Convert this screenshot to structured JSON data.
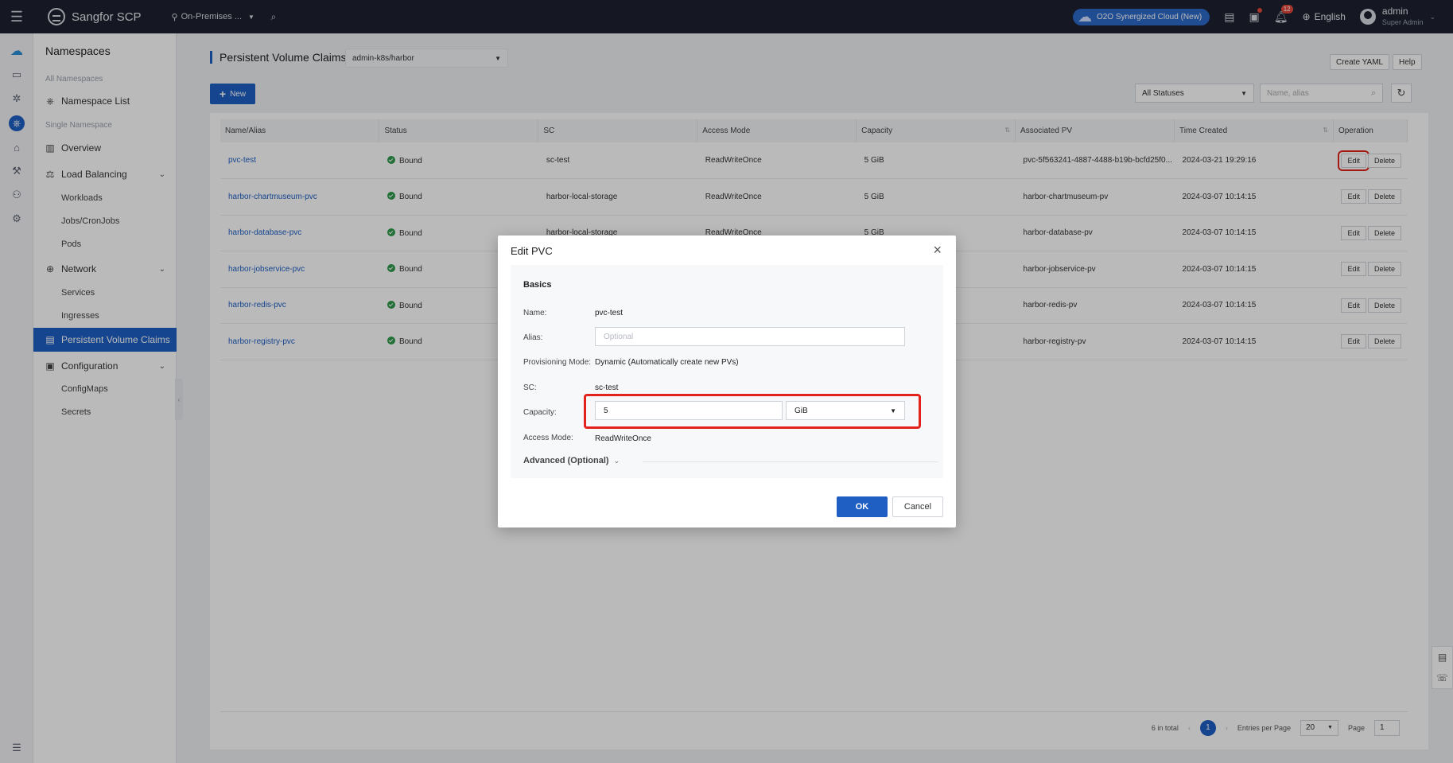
{
  "topbar": {
    "brand": "Sangfor SCP",
    "site": "On-Premises ...",
    "o2o_label": "O2O Synergized Cloud (New)",
    "notification_count": "12",
    "language": "English",
    "user_name": "admin",
    "user_role": "Super Admin"
  },
  "sidebar": {
    "title": "Namespaces",
    "group_all": "All Namespaces",
    "namespace_list": "Namespace List",
    "group_single": "Single Namespace",
    "overview": "Overview",
    "load_balancing": "Load Balancing",
    "workloads": "Workloads",
    "jobs": "Jobs/CronJobs",
    "pods": "Pods",
    "network": "Network",
    "services": "Services",
    "ingresses": "Ingresses",
    "pvc": "Persistent Volume Claims",
    "configuration": "Configuration",
    "configmaps": "ConfigMaps",
    "secrets": "Secrets"
  },
  "page": {
    "title": "Persistent Volume Claims",
    "namespace": "admin-k8s/harbor",
    "create_yaml": "Create YAML",
    "help": "Help",
    "new": "New",
    "status_filter": "All Statuses",
    "search_placeholder": "Name, alias"
  },
  "table": {
    "headers": [
      "Name/Alias",
      "Status",
      "SC",
      "Access Mode",
      "Capacity",
      "Associated PV",
      "Time Created",
      "Operation"
    ],
    "edit_label": "Edit",
    "delete_label": "Delete",
    "rows": [
      {
        "name": "pvc-test",
        "status": "Bound",
        "sc": "sc-test",
        "access": "ReadWriteOnce",
        "capacity": "5 GiB",
        "pv": "pvc-5f563241-4887-4488-b19b-bcfd25f0...",
        "created": "2024-03-21 19:29:16"
      },
      {
        "name": "harbor-chartmuseum-pvc",
        "status": "Bound",
        "sc": "harbor-local-storage",
        "access": "ReadWriteOnce",
        "capacity": "5 GiB",
        "pv": "harbor-chartmuseum-pv",
        "created": "2024-03-07 10:14:15"
      },
      {
        "name": "harbor-database-pvc",
        "status": "Bound",
        "sc": "harbor-local-storage",
        "access": "ReadWriteOnce",
        "capacity": "5 GiB",
        "pv": "harbor-database-pv",
        "created": "2024-03-07 10:14:15"
      },
      {
        "name": "harbor-jobservice-pvc",
        "status": "Bound",
        "sc": "",
        "access": "",
        "capacity": "",
        "pv": "harbor-jobservice-pv",
        "created": "2024-03-07 10:14:15"
      },
      {
        "name": "harbor-redis-pvc",
        "status": "Bound",
        "sc": "",
        "access": "",
        "capacity": "",
        "pv": "harbor-redis-pv",
        "created": "2024-03-07 10:14:15"
      },
      {
        "name": "harbor-registry-pvc",
        "status": "Bound",
        "sc": "",
        "access": "",
        "capacity": "",
        "pv": "harbor-registry-pv",
        "created": "2024-03-07 10:14:15"
      }
    ]
  },
  "pager": {
    "total": "6 in total",
    "current_page": "1",
    "entries_label": "Entries per Page",
    "entries_value": "20",
    "page_label": "Page",
    "page_value": "1"
  },
  "modal": {
    "title": "Edit PVC",
    "section": "Basics",
    "name_label": "Name:",
    "name_value": "pvc-test",
    "alias_label": "Alias:",
    "alias_placeholder": "Optional",
    "mode_label": "Provisioning Mode:",
    "mode_value": "Dynamic (Automatically create new PVs)",
    "sc_label": "SC:",
    "sc_value": "sc-test",
    "capacity_label": "Capacity:",
    "capacity_value": "5",
    "capacity_unit": "GiB",
    "access_label": "Access Mode:",
    "access_value": "ReadWriteOnce",
    "advanced": "Advanced (Optional)",
    "ok": "OK",
    "cancel": "Cancel"
  },
  "colors": {
    "primary": "#1f5fc4",
    "topbar": "#1d2230",
    "highlight": "#e3231b",
    "bound": "#2e9a4a"
  }
}
